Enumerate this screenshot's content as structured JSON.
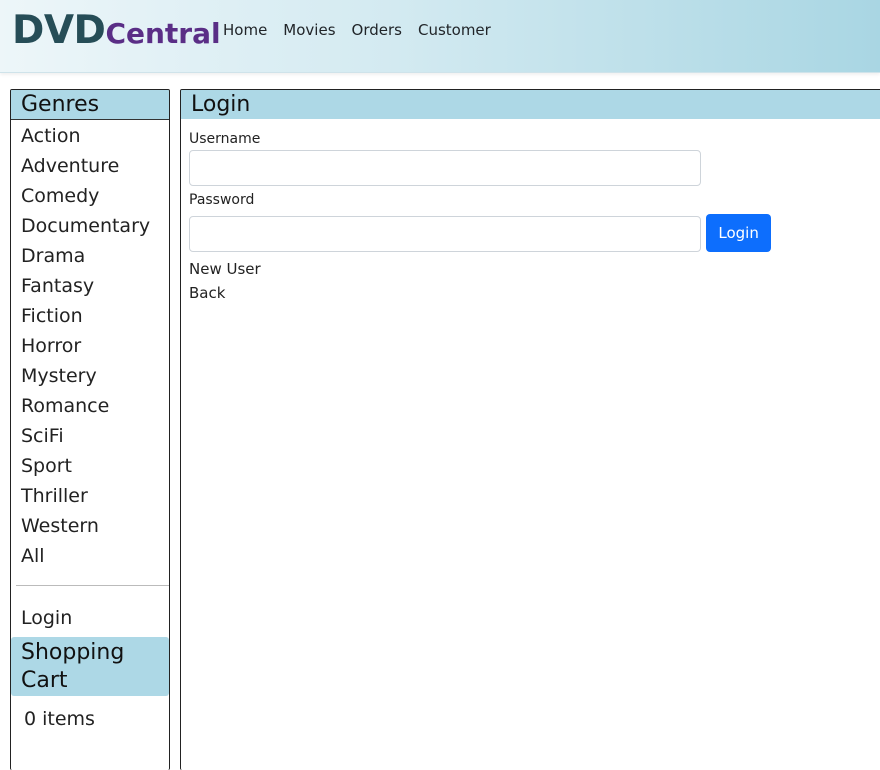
{
  "brand": {
    "part1": "DVD",
    "part2": "Central"
  },
  "nav": [
    "Home",
    "Movies",
    "Orders",
    "Customer"
  ],
  "sidebar": {
    "genres_title": "Genres",
    "genres": [
      "Action",
      "Adventure",
      "Comedy",
      "Documentary",
      "Drama",
      "Fantasy",
      "Fiction",
      "Horror",
      "Mystery",
      "Romance",
      "SciFi",
      "Sport",
      "Thriller",
      "Western",
      "All"
    ],
    "login": "Login",
    "cart_title": "Shopping Cart",
    "cart_count": "0 items"
  },
  "main": {
    "title": "Login",
    "username_label": "Username",
    "username_value": "",
    "password_label": "Password",
    "password_value": "",
    "login_button": "Login",
    "new_user_link": "New User",
    "back_link": "Back"
  },
  "colors": {
    "accent": "#add8e6",
    "button": "#0d6efd",
    "brand_dvd": "#264d57",
    "brand_central": "#5a2e86"
  }
}
